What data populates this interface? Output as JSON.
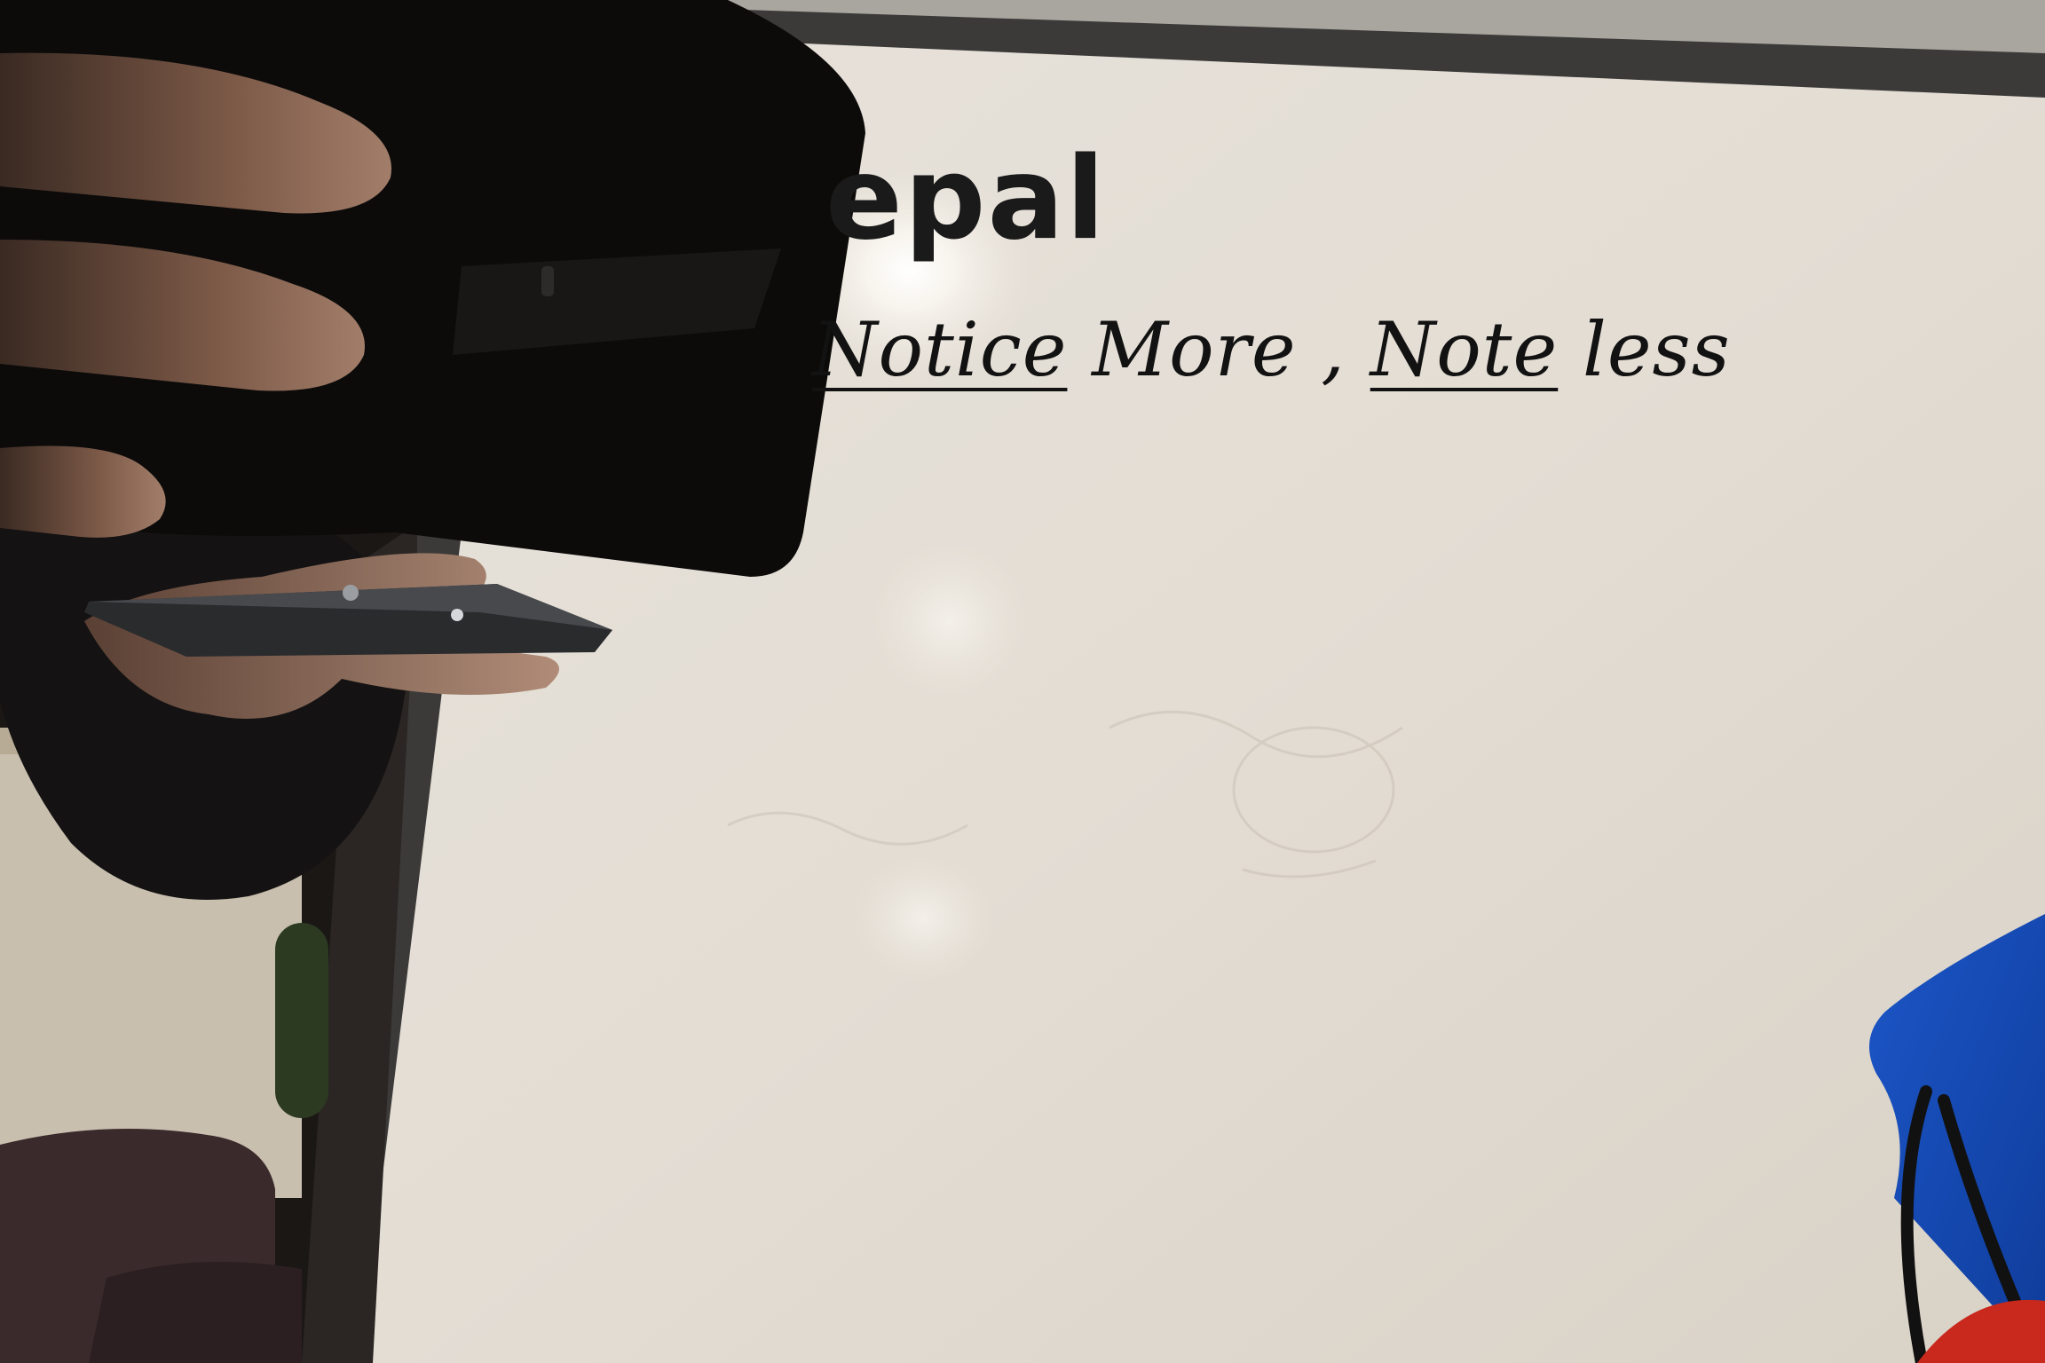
{
  "whiteboard": {
    "title": "epal",
    "subtitle_part1": "Notice",
    "subtitle_part2": " More , ",
    "subtitle_part3": "Note",
    "subtitle_part4": " less"
  }
}
